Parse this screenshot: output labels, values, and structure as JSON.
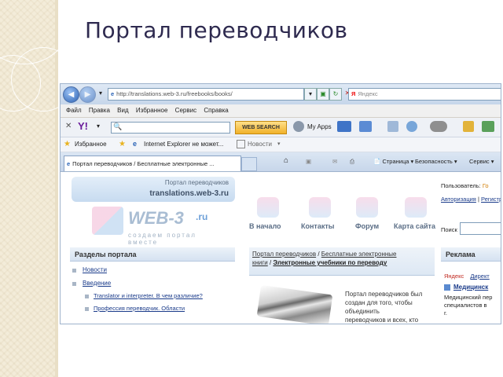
{
  "slide": {
    "title": "Портал переводчиков"
  },
  "browser": {
    "address": "http://translations.web-3.ru/freebooks/books/",
    "search_engine": "Яндекс",
    "menu": [
      "Файл",
      "Правка",
      "Вид",
      "Избранное",
      "Сервис",
      "Справка"
    ],
    "yahoo": {
      "logo": "Y!",
      "web_search": "WEB SEARCH",
      "my_apps": "My Apps"
    },
    "favorites": {
      "label": "Избранное",
      "item1": "Internet Explorer не может...",
      "item2": "Новости"
    },
    "tab_title": "Портал переводчиков / Бесплатные электронные ...",
    "commands": {
      "page": "Страница",
      "security": "Безопасность",
      "service": "Сервис"
    }
  },
  "site": {
    "header_line1": "Портал переводчиков",
    "header_line2": "translations.web-3.ru",
    "logo_text": "WEB-3",
    "logo_ru": ".ru",
    "slogan": "создаем портал вместе",
    "nav": [
      "В начало",
      "Контакты",
      "Форум",
      "Карта сайта"
    ],
    "user_label": "Пользователь:",
    "user_guest": "Го",
    "auth_link": "Авторизация",
    "auth_sep": "|",
    "register_link": "Регистр",
    "search_label": "Поиск",
    "sidebar_title": "Разделы портала",
    "sidebar_items": [
      "Новости",
      "Введение"
    ],
    "sidebar_subitems": [
      "Translator и interpreter. В чем различие?",
      "Профессия переводчик. Области"
    ],
    "breadcrumb_1": "Портал переводчиков",
    "breadcrumb_sep": "/",
    "breadcrumb_2": "Бесплатные электронные",
    "breadcrumb_3": "книги",
    "breadcrumb_4": "Электронные учебники по переводу",
    "article_text": [
      "Портал переводчиков был",
      "создан для того, чтобы",
      "объединить",
      "переводчиков и всех, кто"
    ],
    "ads_title": "Реклама",
    "ads_yandex": "Яндекс",
    "ads_direct": "Директ",
    "ad_link": "Медицинск",
    "ad_text": [
      "Медицинский пер",
      "специалистов в",
      "г."
    ]
  }
}
